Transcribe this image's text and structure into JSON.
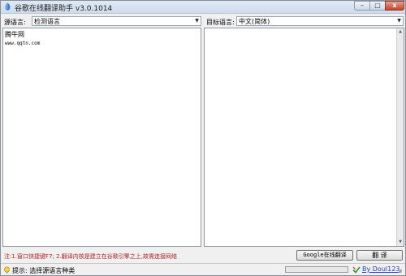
{
  "window": {
    "title": "谷歌在线翻译助手 v3.0.1014",
    "min_label": "–",
    "max_label": "□",
    "close_label": "x"
  },
  "source": {
    "label": "源语言:",
    "selected": "检测语言",
    "text_title": "腾牛网",
    "text_url": "www.qqtn.com"
  },
  "target": {
    "label": "目标语言:",
    "selected": "中文(简体)",
    "text": ""
  },
  "note": "注:1.窗口快捷键F7;  2.翻译内核是建立在谷歌引擎之上,故需连接网络",
  "buttons": {
    "google": "Google在线翻译",
    "translate": "翻 译"
  },
  "status": {
    "text": "提示: 选择源语言种类",
    "progress_fraction": 0,
    "credit": "By Doul123"
  },
  "colors": {
    "note": "#b22222",
    "link": "#1a3fcf"
  }
}
